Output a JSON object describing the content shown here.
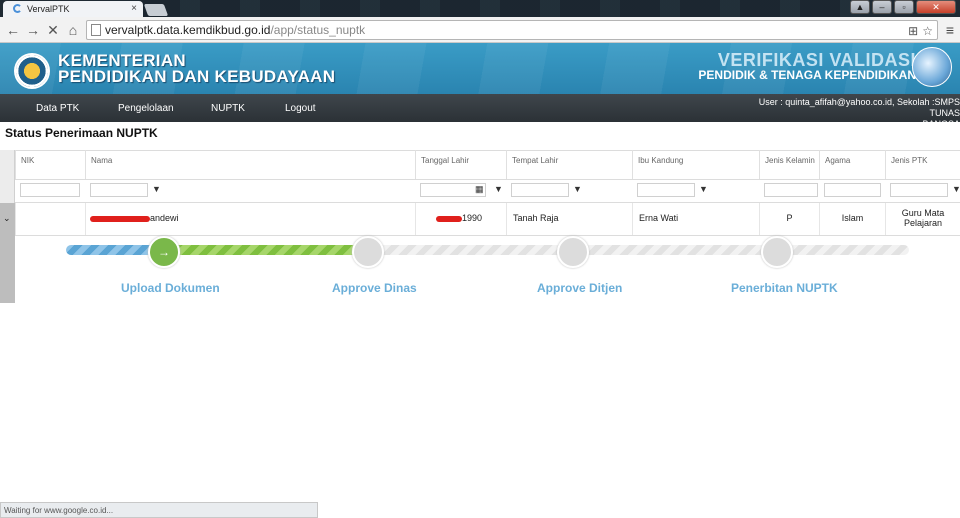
{
  "browser": {
    "tab_title": "VervalPTK",
    "tab_close": "×",
    "url_host": "vervalptk.data.kemdikbud.go.id",
    "url_path": "/app/status_nuptk",
    "status_text": "Waiting for www.google.co.id..."
  },
  "header": {
    "ministry_line1": "KEMENTERIAN",
    "ministry_line2": "PENDIDIKAN DAN KEBUDAYAAN",
    "verif_line1": "VERIFIKASI VALIDASI",
    "verif_line2": "PENDIDIK & TENAGA KEPENDIDIKAN"
  },
  "nav": {
    "items": [
      "Data PTK",
      "Pengelolaan",
      "NUPTK",
      "Logout"
    ],
    "user_line1": "User : quinta_afifah@yahoo.co.id, Sekolah :SMPS TUNAS",
    "user_line2": "BANGSA"
  },
  "page_title": "Status Penerimaan NUPTK",
  "grid": {
    "columns": [
      "NIK",
      "Nama",
      "Tanggal Lahir",
      "Tempat Lahir",
      "Ibu Kandung",
      "Jenis Kelamin",
      "Agama",
      "Jenis PTK"
    ],
    "row": {
      "nik": "",
      "nama": "andewi",
      "tanggal_lahir": "1990",
      "tempat_lahir": "Tanah Raja",
      "ibu_kandung": "Erna Wati",
      "jenis_kelamin": "P",
      "agama": "Islam",
      "jenis_ptk": "Guru Mata Pelajaran"
    }
  },
  "progress": {
    "current_step": 1,
    "steps": [
      "Upload Dokumen",
      "Approve Dinas",
      "Approve Ditjen",
      "Penerbitan NUPTK"
    ]
  }
}
